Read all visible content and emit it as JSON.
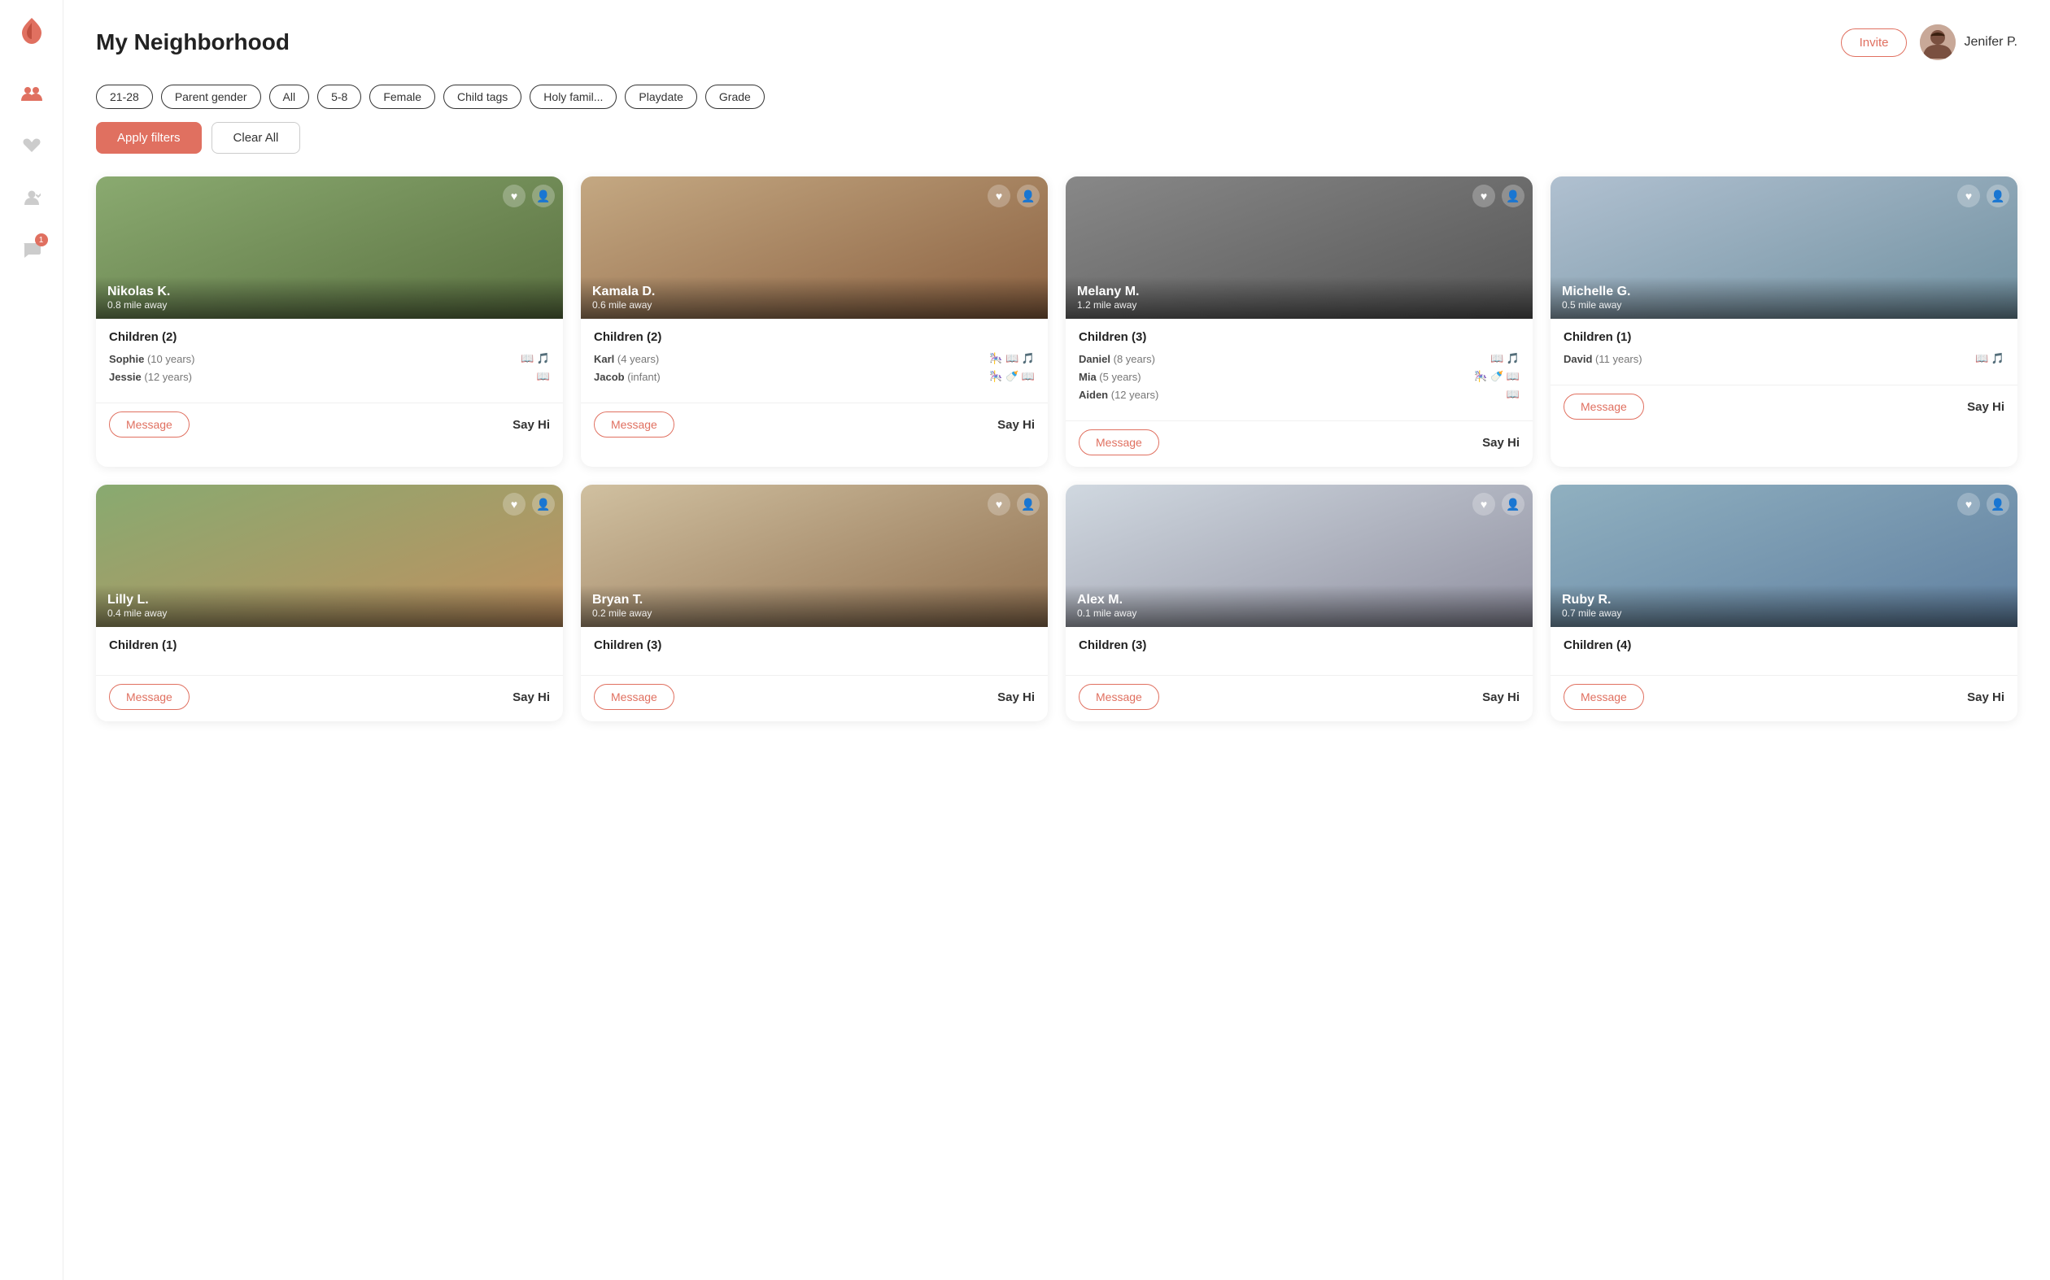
{
  "app": {
    "title": "My Neighborhood",
    "logo_color": "#e07060"
  },
  "header": {
    "title": "My Neighborhood",
    "invite_label": "Invite",
    "user_name": "Jenifer P."
  },
  "filters": [
    {
      "id": "age",
      "label": "21-28"
    },
    {
      "id": "parent_gender",
      "label": "Parent gender"
    },
    {
      "id": "all",
      "label": "All"
    },
    {
      "id": "child_age",
      "label": "5-8"
    },
    {
      "id": "gender",
      "label": "Female"
    },
    {
      "id": "child_tags",
      "label": "Child tags"
    },
    {
      "id": "holy_family",
      "label": "Holy famil..."
    },
    {
      "id": "playdate",
      "label": "Playdate"
    },
    {
      "id": "grade",
      "label": "Grade"
    }
  ],
  "actions": {
    "apply_label": "Apply filters",
    "clear_label": "Clear All"
  },
  "sidebar": {
    "items": [
      {
        "id": "neighborhood",
        "icon": "people",
        "active": true
      },
      {
        "id": "favorites",
        "icon": "heart",
        "active": false
      },
      {
        "id": "connections",
        "icon": "person-check",
        "active": false
      },
      {
        "id": "messages",
        "icon": "chat",
        "active": false,
        "badge": "1"
      }
    ]
  },
  "cards": [
    {
      "id": "nikolas",
      "name": "Nikolas K.",
      "distance": "0.8 mile away",
      "img_class": "img-nikolas",
      "children_label": "Children (2)",
      "children": [
        {
          "name": "Sophie",
          "age": "10 years",
          "icons": [
            "book",
            "music"
          ]
        },
        {
          "name": "Jessie",
          "age": "12 years",
          "icons": [
            "book"
          ]
        }
      ]
    },
    {
      "id": "kamala",
      "name": "Kamala D.",
      "distance": "0.6 mile away",
      "img_class": "img-kamala",
      "children_label": "Children (2)",
      "children": [
        {
          "name": "Karl",
          "age": "4 years",
          "icons": [
            "toy",
            "book",
            "music"
          ]
        },
        {
          "name": "Jacob",
          "age": "infant",
          "icons": [
            "toy",
            "baby",
            "book"
          ]
        }
      ]
    },
    {
      "id": "melany",
      "name": "Melany M.",
      "distance": "1.2 mile away",
      "img_class": "img-melany",
      "children_label": "Children (3)",
      "children": [
        {
          "name": "Daniel",
          "age": "8 years",
          "icons": [
            "book",
            "music"
          ]
        },
        {
          "name": "Mia",
          "age": "5 years",
          "icons": [
            "toy",
            "baby",
            "book"
          ]
        },
        {
          "name": "Aiden",
          "age": "12 years",
          "icons": [
            "book"
          ]
        }
      ]
    },
    {
      "id": "michelle",
      "name": "Michelle G.",
      "distance": "0.5 mile away",
      "img_class": "img-michelle",
      "children_label": "Children (1)",
      "children": [
        {
          "name": "David",
          "age": "11 years",
          "icons": [
            "book",
            "music"
          ]
        }
      ]
    },
    {
      "id": "lilly",
      "name": "Lilly L.",
      "distance": "0.4 mile away",
      "img_class": "img-lilly",
      "children_label": "Children (1)",
      "children": []
    },
    {
      "id": "bryan",
      "name": "Bryan T.",
      "distance": "0.2 mile away",
      "img_class": "img-bryan",
      "children_label": "Children (3)",
      "children": []
    },
    {
      "id": "alex",
      "name": "Alex M.",
      "distance": "0.1 mile away",
      "img_class": "img-alex",
      "children_label": "Children (3)",
      "children": []
    },
    {
      "id": "ruby",
      "name": "Ruby R.",
      "distance": "0.7 mile away",
      "img_class": "img-ruby",
      "children_label": "Children (4)",
      "children": []
    }
  ],
  "card_footer": {
    "message_label": "Message",
    "say_hi_label": "Say Hi"
  }
}
